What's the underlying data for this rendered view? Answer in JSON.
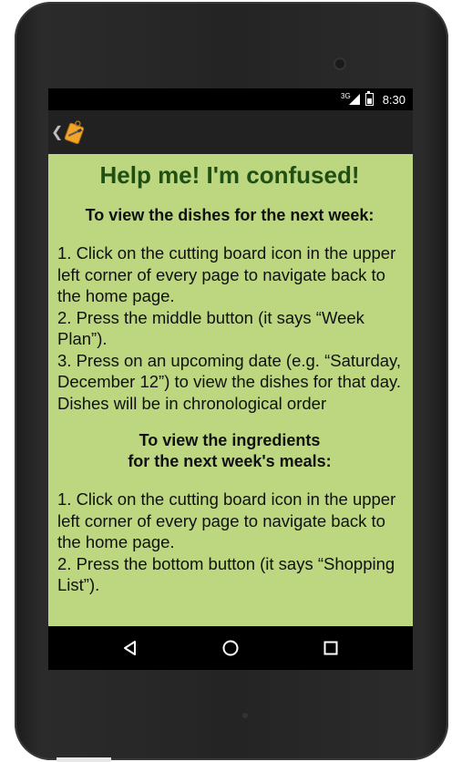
{
  "status_bar": {
    "network": "3G",
    "time": "8:30"
  },
  "action_bar": {
    "back_icon": "chevron-left-icon",
    "app_icon": "cutting-board-icon"
  },
  "content": {
    "title": "Help me! I'm confused!",
    "section1": {
      "heading": "To view the dishes for the next week:",
      "steps": [
        "1. Click on the cutting board icon in the upper left corner of every page to navigate back to the home page.",
        "2. Press the middle button (it says “Week Plan”).",
        "3. Press on an upcoming date (e.g. “Saturday, December 12”) to view the dishes for that day. Dishes will be in chronological order"
      ]
    },
    "section2": {
      "heading_line1": "To view the ingredients",
      "heading_line2": "for the next week's meals:",
      "steps": [
        "1. Click on the cutting board icon in the upper left corner of every page to navigate back to the home page.",
        "2. Press the bottom button (it says “Shopping List”)."
      ]
    }
  },
  "colors": {
    "content_background": "#bdd680",
    "title_color": "#1f4f12",
    "action_bar": "#212121"
  },
  "nav_bar": {
    "back": "back-triangle-icon",
    "home": "home-circle-icon",
    "recents": "recents-square-icon"
  }
}
